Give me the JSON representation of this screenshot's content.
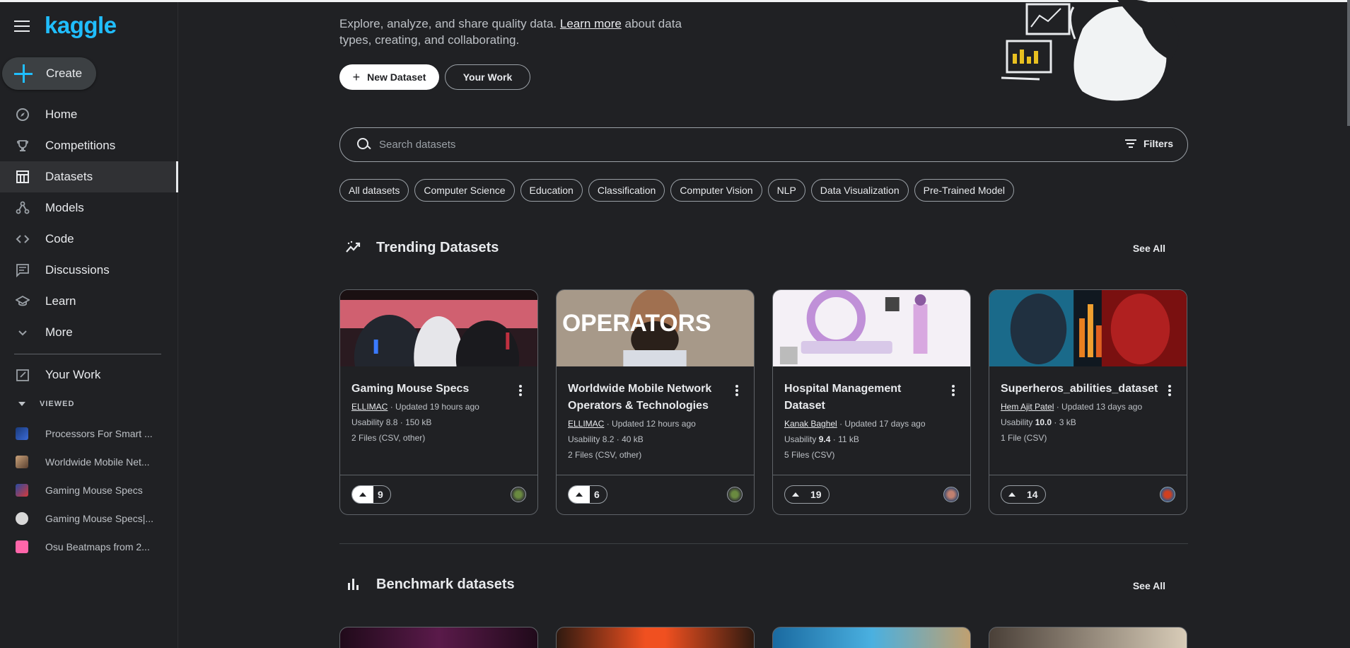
{
  "app": {
    "logo": "kaggle"
  },
  "sidebar": {
    "create_label": "Create",
    "items": [
      {
        "label": "Home",
        "icon": "compass-icon"
      },
      {
        "label": "Competitions",
        "icon": "trophy-icon"
      },
      {
        "label": "Datasets",
        "icon": "table-icon",
        "active": true
      },
      {
        "label": "Models",
        "icon": "models-icon"
      },
      {
        "label": "Code",
        "icon": "code-icon"
      },
      {
        "label": "Discussions",
        "icon": "comments-icon"
      },
      {
        "label": "Learn",
        "icon": "school-icon"
      },
      {
        "label": "More",
        "icon": "chevron-down-icon"
      }
    ],
    "your_work": "Your Work",
    "viewed_header": "VIEWED",
    "viewed": [
      {
        "label": "Processors For Smart ..."
      },
      {
        "label": "Worldwide Mobile Net..."
      },
      {
        "label": "Gaming Mouse Specs"
      },
      {
        "label": "Gaming Mouse Specs|..."
      },
      {
        "label": "Osu Beatmaps from 2..."
      }
    ]
  },
  "main": {
    "intro_text": "Explore, analyze, and share quality data.",
    "intro_link": "Learn more",
    "intro_text2": "about data types, creating, and collaborating.",
    "new_dataset_label": "New Dataset",
    "your_work_label": "Your Work",
    "search_placeholder": "Search datasets",
    "filters_label": "Filters",
    "chips": [
      "All datasets",
      "Computer Science",
      "Education",
      "Classification",
      "Computer Vision",
      "NLP",
      "Data Visualization",
      "Pre-Trained Model"
    ],
    "trending": {
      "title": "Trending Datasets",
      "see_all": "See All",
      "cards": [
        {
          "title": "Gaming Mouse Specs",
          "owner": "ELLIMAC",
          "updated": "· Updated 19 hours ago",
          "usability_label": "Usability",
          "usability": "8.8",
          "size": "· 150 kB",
          "files": "2 Files (CSV, other)",
          "votes": "9",
          "voted": true
        },
        {
          "title": "Worldwide Mobile Network Operators & Technologies",
          "owner": "ELLIMAC",
          "updated": "· Updated 12 hours ago",
          "usability_label": "Usability",
          "usability": "8.2",
          "size": "· 40 kB",
          "files": "2 Files (CSV, other)",
          "votes": "6",
          "voted": true,
          "img_text": "OPERATORS"
        },
        {
          "title": "Hospital Management Dataset",
          "owner": "Kanak Baghel",
          "updated": "· Updated 17 days ago",
          "usability_label": "Usability",
          "usability": "9.4",
          "size": "· 11 kB",
          "files": "5 Files (CSV)",
          "votes": "19",
          "voted": false
        },
        {
          "title": "Superheros_abilities_dataset",
          "owner": "Hem Ajit Patel",
          "updated": "· Updated 13 days ago",
          "usability_label": "Usability",
          "usability": "10.0",
          "size": "· 3 kB",
          "files": "1 File (CSV)",
          "votes": "14",
          "voted": false
        }
      ]
    },
    "benchmark": {
      "title": "Benchmark datasets",
      "see_all": "See All"
    }
  },
  "colors": {
    "accent": "#20beff",
    "background": "#202124",
    "text": "#e8eaed"
  }
}
